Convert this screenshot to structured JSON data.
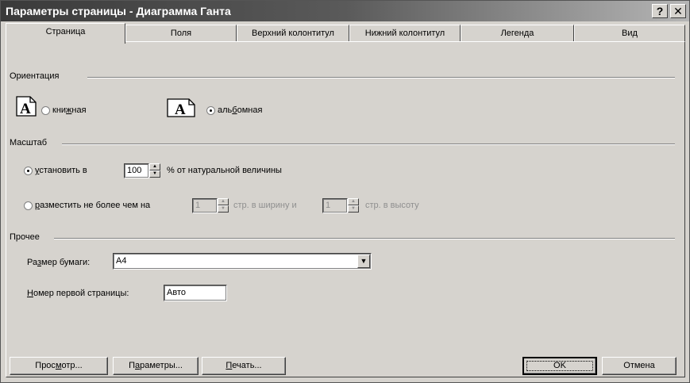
{
  "window": {
    "title": "Параметры страницы - Диаграмма Ганта",
    "help_glyph": "?",
    "close_glyph": "✕"
  },
  "tabs": [
    {
      "label": "Страница",
      "active": true
    },
    {
      "label": "Поля",
      "active": false
    },
    {
      "label": "Верхний колонтитул",
      "active": false
    },
    {
      "label": "Нижний колонтитул",
      "active": false
    },
    {
      "label": "Легенда",
      "active": false
    },
    {
      "label": "Вид",
      "active": false
    }
  ],
  "orientation": {
    "title": "Ориентация",
    "portrait": {
      "label_pre": "кни",
      "label_acc": "ж",
      "label_post": "ная",
      "checked": false,
      "icon": "portrait-page-icon",
      "glyph": "A"
    },
    "landscape": {
      "label_pre": "аль",
      "label_acc": "б",
      "label_post": "омная",
      "checked": true,
      "icon": "landscape-page-icon",
      "glyph": "A"
    }
  },
  "scale": {
    "title": "Масштаб",
    "adjust": {
      "label_acc": "у",
      "label_post": "становить в",
      "value": "100",
      "suffix": "% от натуральной величины",
      "checked": true
    },
    "fit": {
      "label_acc": "р",
      "label_post": "азместить не более чем на",
      "wide_value": "1",
      "wide_suffix": "стр. в ширину и",
      "tall_value": "1",
      "tall_suffix": "стр. в высоту",
      "checked": false
    }
  },
  "other": {
    "title": "Прочее",
    "paper_label_pre": "Ра",
    "paper_label_acc": "з",
    "paper_label_post": "мер бумаги:",
    "paper_value": "A4",
    "first_page_label_acc": "Н",
    "first_page_label_post": "омер первой страницы:",
    "first_page_value": "Авто"
  },
  "buttons": {
    "preview_pre": "Прос",
    "preview_acc": "м",
    "preview_post": "отр...",
    "options_pre": "П",
    "options_acc": "а",
    "options_post": "раметры...",
    "print_acc": "П",
    "print_post": "ечать...",
    "ok": "OK",
    "cancel": "Отмена"
  }
}
